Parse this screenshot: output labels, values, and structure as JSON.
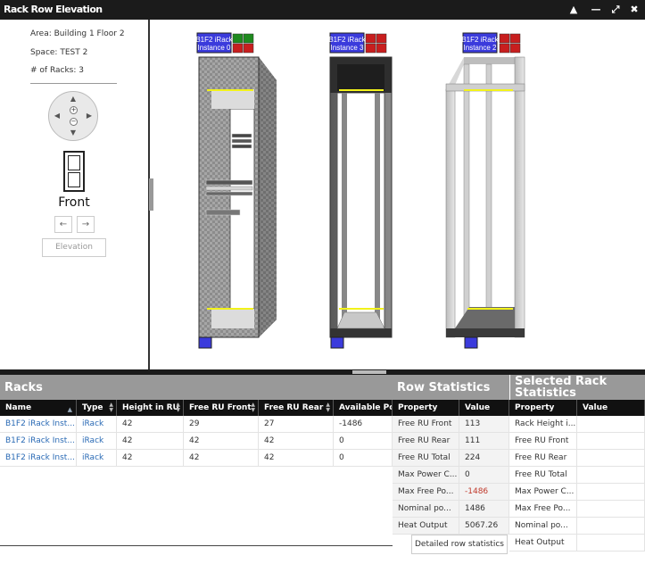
{
  "window": {
    "title": "Rack Row Elevation",
    "controls": [
      "minimize",
      "restore",
      "maximize",
      "close"
    ]
  },
  "sidebar": {
    "area": "Area: Building 1 Floor 2",
    "space": "Space: TEST 2",
    "num_racks": "# of Racks: 3",
    "view_label": "Front",
    "elevation_button": "Elevation"
  },
  "racks": [
    {
      "label_line1": "B1F2 iRack",
      "label_line2": "Instance 0",
      "style": "solid",
      "power_colors": [
        "#1e8a1e",
        "#1e8a1e",
        "#c81e1e",
        "#c81e1e"
      ]
    },
    {
      "label_line1": "B1F2 iRack",
      "label_line2": "Instance 3",
      "style": "panel",
      "power_colors": [
        "#c81e1e",
        "#c81e1e",
        "#c81e1e",
        "#c81e1e"
      ]
    },
    {
      "label_line1": "B1F2 iRack",
      "label_line2": "Instance 2",
      "style": "open",
      "power_colors": [
        "#c81e1e",
        "#c81e1e",
        "#c81e1e",
        "#c81e1e"
      ]
    }
  ],
  "racks_table": {
    "title": "Racks",
    "columns": [
      "Name",
      "Type",
      "Height in RU",
      "Free RU Front",
      "Free RU Rear",
      "Available Po..."
    ],
    "rows": [
      [
        "B1F2 iRack Inst...",
        "iRack",
        "42",
        "29",
        "27",
        "-1486"
      ],
      [
        "B1F2 iRack Inst...",
        "iRack",
        "42",
        "42",
        "42",
        "0"
      ],
      [
        "B1F2 iRack Inst...",
        "iRack",
        "42",
        "42",
        "42",
        "0"
      ]
    ]
  },
  "row_statistics": {
    "title": "Row Statistics",
    "columns": [
      "Property",
      "Value"
    ],
    "rows": [
      [
        "Free RU Front",
        "113"
      ],
      [
        "Free RU Rear",
        "111"
      ],
      [
        "Free RU Total",
        "224"
      ],
      [
        "Max Power C...",
        "0"
      ],
      [
        "Max Free Po...",
        "-1486"
      ],
      [
        "Nominal po...",
        "1486"
      ],
      [
        "Heat Output",
        "5067.26"
      ]
    ],
    "negative_color": "#c0392b",
    "detail_button": "Detailed row statistics"
  },
  "selected_rack_statistics": {
    "title_line1": "Selected Rack",
    "title_line2": "Statistics",
    "columns": [
      "Property",
      "Value"
    ],
    "rows": [
      [
        "Rack Height i...",
        ""
      ],
      [
        "Free RU Front",
        ""
      ],
      [
        "Free RU Rear",
        ""
      ],
      [
        "Free RU Total",
        ""
      ],
      [
        "Max Power C...",
        ""
      ],
      [
        "Max Free Po...",
        ""
      ],
      [
        "Nominal po...",
        ""
      ],
      [
        "Heat Output",
        ""
      ]
    ]
  },
  "colors": {
    "titlebar": "#1b1b1b",
    "section_header": "#999999",
    "column_header": "#111111",
    "link": "#2a6ab5",
    "rack_label_bg": "#3b3bdc",
    "yellow_rail": "#f2f21a"
  }
}
